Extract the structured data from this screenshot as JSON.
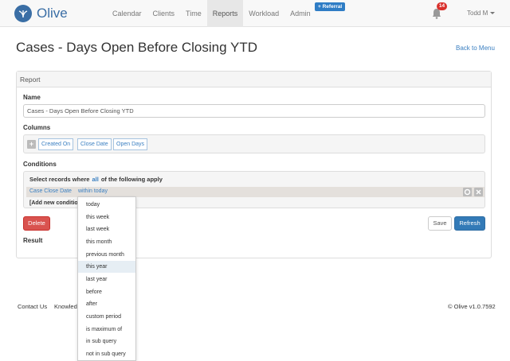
{
  "app": {
    "name": "Olive"
  },
  "nav": {
    "items": [
      "Calendar",
      "Clients",
      "Time",
      "Reports",
      "Workload",
      "Admin"
    ],
    "active": "Reports",
    "referral": "+ Referral",
    "notification_count": "14",
    "user": "Todd M"
  },
  "page": {
    "title": "Cases - Days Open Before Closing YTD",
    "back_link": "Back to Menu"
  },
  "report": {
    "heading": "Report",
    "name_label": "Name",
    "name_value": "Cases - Days Open Before Closing YTD",
    "columns_label": "Columns",
    "columns": [
      "Created On",
      "Close Date",
      "Open Days"
    ],
    "conditions_label": "Conditions",
    "conditions_prefix": "Select records where",
    "conditions_match": "all",
    "conditions_suffix": "of the following apply",
    "condition_field": "Case Close Date",
    "condition_operator": "within today",
    "add_condition": "[Add new condition",
    "delete_label": "Delete",
    "save_label": "Save",
    "refresh_label": "Refresh",
    "result_label": "Result"
  },
  "operator_dropdown": {
    "items": [
      "today",
      "this week",
      "last week",
      "this month",
      "previous month",
      "this year",
      "last year",
      "before",
      "after",
      "custom period",
      "is maximum of",
      "in sub query",
      "not in sub query"
    ],
    "highlighted": "this year"
  },
  "footer": {
    "contact": "Contact Us",
    "knowledge": "Knowled",
    "version": "© Olive v1.0.7592"
  },
  "colors": {
    "brand": "#3a6ea5",
    "link": "#3a7fc1",
    "danger": "#d9534f",
    "primary": "#337ab7",
    "badge": "#d9302c"
  }
}
